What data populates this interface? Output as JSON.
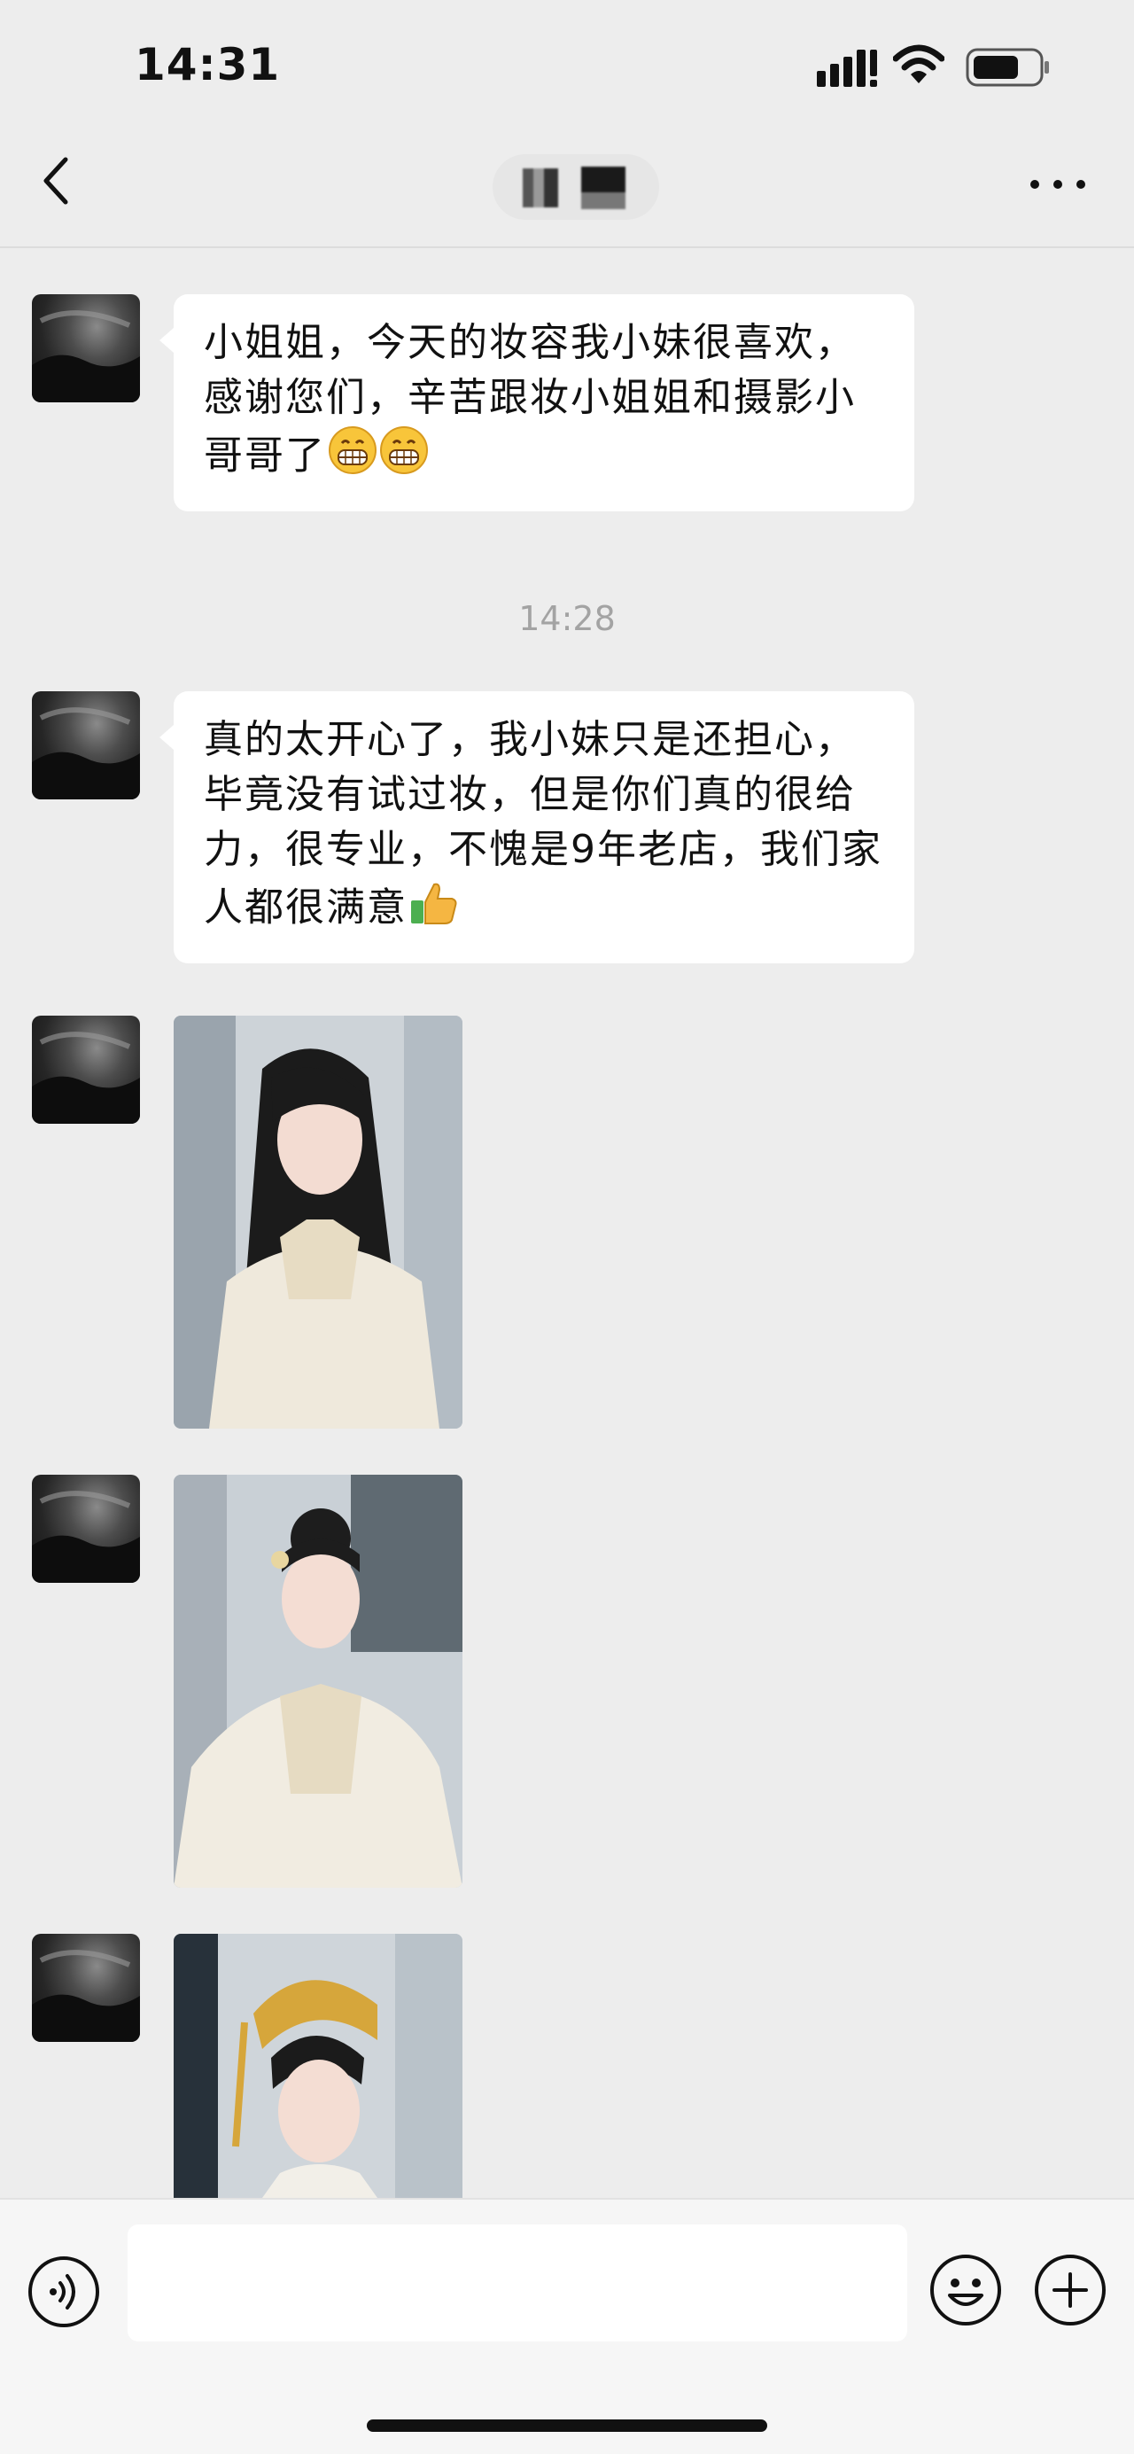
{
  "status_bar": {
    "time": "14:31"
  },
  "nav": {
    "title_blurred": "",
    "back_icon": "chevron-left-icon",
    "more_icon": "more-dots-icon"
  },
  "messages": [
    {
      "type": "text",
      "text": "小姐姐，今天的妆容我小妹很喜欢，感谢您们，辛苦跟妆小姐姐和摄影小哥哥了",
      "emojis": [
        "grin-emoji",
        "grin-emoji"
      ]
    },
    {
      "type": "time",
      "text": "14:28"
    },
    {
      "type": "text",
      "text": "真的太开心了，我小妹只是还担心，毕竟没有试过妆，但是你们真的很给力，很专业，不愧是9年老店，我们家人都很满意",
      "emojis": [
        "thumbs-up-emoji"
      ]
    },
    {
      "type": "image",
      "content": "bride-photo-1"
    },
    {
      "type": "image",
      "content": "bride-photo-2"
    },
    {
      "type": "image",
      "content": "bride-photo-3"
    }
  ],
  "input_bar": {
    "placeholder": "",
    "voice_icon": "voice-icon",
    "emoji_icon": "smiley-icon",
    "plus_icon": "plus-icon"
  },
  "colors": {
    "background": "#ededed",
    "bubble": "#ffffff",
    "timestamp": "#a3a3a3"
  }
}
